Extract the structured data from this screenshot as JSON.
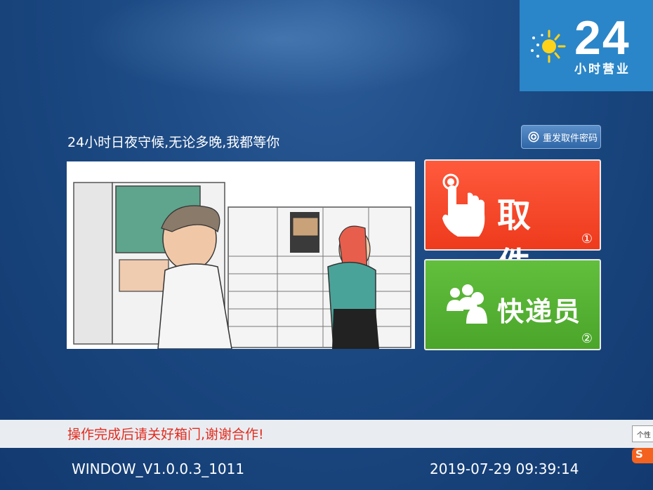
{
  "logo": {
    "number": "24",
    "text": "小时营业",
    "icon": "sun-moon-icon"
  },
  "header": {
    "slogan": "24小时日夜守候,无论多晚,我都等你"
  },
  "reset_button": {
    "label": "重发取件密码",
    "icon": "search-plus-icon"
  },
  "actions": [
    {
      "label": "取 件",
      "number": "①",
      "icon": "hand-tap-icon",
      "color": "#f0411f"
    },
    {
      "label": "快递员",
      "number": "②",
      "icon": "users-icon",
      "color": "#52ad30"
    }
  ],
  "notice": "操作完成后请关好箱门,谢谢合作!",
  "footer": {
    "version": "WINDOW_V1.0.0.3_1011",
    "datetime": "2019-07-29 09:39:14"
  },
  "taskbar": {
    "tooltip": "个性",
    "ime_label": "S"
  },
  "illustration": {
    "description_icon": "locker-illustration"
  }
}
